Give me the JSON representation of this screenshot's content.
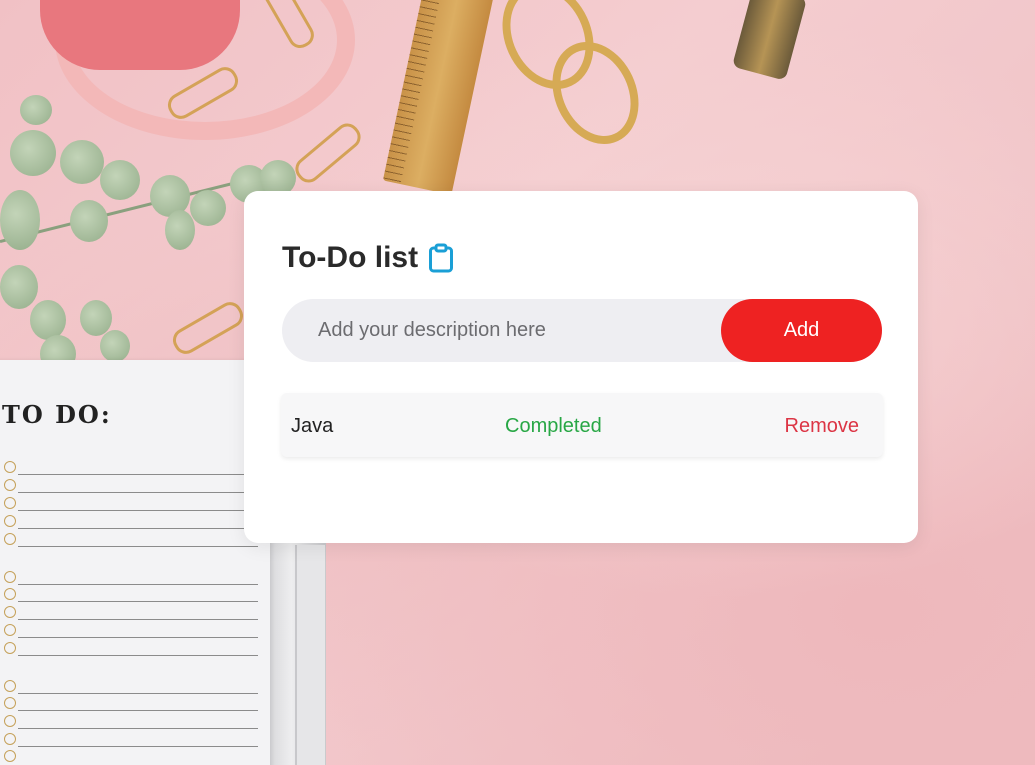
{
  "app": {
    "title": "To-Do list",
    "title_icon": "clipboard-icon",
    "accent_color": "#ee2222",
    "icon_color": "#1a9fd6"
  },
  "form": {
    "placeholder": "Add your description here",
    "value": "",
    "add_label": "Add"
  },
  "tasks": [
    {
      "name": "Java",
      "status": "Completed",
      "remove_label": "Remove"
    }
  ],
  "background": {
    "notepad_heading": "TO DO:"
  }
}
